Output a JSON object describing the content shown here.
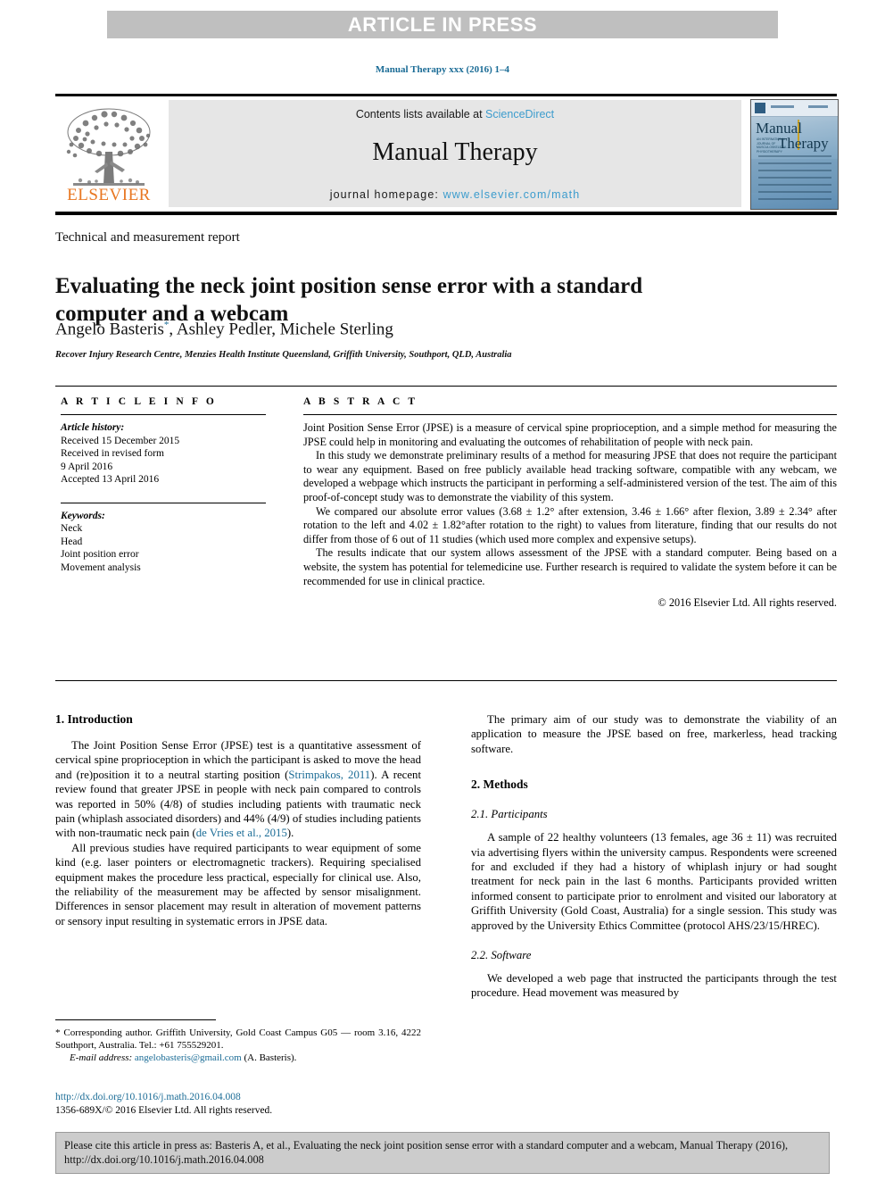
{
  "banner": {
    "text": "ARTICLE IN PRESS"
  },
  "running_head": "Manual Therapy xxx (2016) 1–4",
  "masthead": {
    "contents_prefix": "Contents lists available at ",
    "contents_link": "ScienceDirect",
    "journal_title": "Manual Therapy",
    "homepage_prefix": "journal homepage: ",
    "homepage_url": "www.elsevier.com/math",
    "publisher_wordmark": "ELSEVIER",
    "cover": {
      "title_part1": "Manual",
      "title_part2": "Therapy",
      "subtext": "AN INTERNATIONAL JOURNAL OF MUSCULOSKELETAL PHYSIOTHERAPY"
    }
  },
  "article": {
    "section_label": "Technical and measurement report",
    "title": "Evaluating the neck joint position sense error with a standard computer and a webcam",
    "authors": "Angelo Basteris",
    "corresponding_marker": "*",
    "authors_rest": ", Ashley Pedler, Michele Sterling",
    "affiliation": "Recover Injury Research Centre, Menzies Health Institute Queensland, Griffith University, Southport, QLD, Australia"
  },
  "article_info": {
    "heading": "A R T I C L E   I N F O",
    "history_label": "Article history:",
    "history": [
      "Received 15 December 2015",
      "Received in revised form",
      "9 April 2016",
      "Accepted 13 April 2016"
    ],
    "keywords_label": "Keywords:",
    "keywords": [
      "Neck",
      "Head",
      "Joint position error",
      "Movement analysis"
    ]
  },
  "abstract": {
    "heading": "A B S T R A C T",
    "paragraphs": [
      "Joint Position Sense Error (JPSE) is a measure of cervical spine proprioception, and a simple method for measuring the JPSE could help in monitoring and evaluating the outcomes of rehabilitation of people with neck pain.",
      "In this study we demonstrate preliminary results of a method for measuring JPSE that does not require the participant to wear any equipment. Based on free publicly available head tracking software, compatible with any webcam, we developed a webpage which instructs the participant in performing a self-administered version of the test. The aim of this proof-of-concept study was to demonstrate the viability of this system.",
      "We compared our absolute error values (3.68 ± 1.2° after extension, 3.46 ± 1.66° after flexion, 3.89 ± 2.34° after rotation to the left and 4.02 ± 1.82°after rotation to the right) to values from literature, finding that our results do not differ from those of 6 out of 11 studies (which used more complex and expensive setups).",
      "The results indicate that our system allows assessment of the JPSE with a standard computer. Being based on a website, the system has potential for telemedicine use. Further research is required to validate the system before it can be recommended for use in clinical practice."
    ],
    "copyright": "© 2016 Elsevier Ltd. All rights reserved."
  },
  "body": {
    "left": {
      "h1": "1. Introduction",
      "p1_a": "The Joint Position Sense Error (JPSE) test is a quantitative assessment of cervical spine proprioception in which the participant is asked to move the head and (re)position it to a neutral starting position (",
      "p1_cite1": "Strimpakos, 2011",
      "p1_b": "). A recent review found that greater JPSE in people with neck pain compared to controls was reported in 50% (4/8) of studies including patients with traumatic neck pain (whiplash associated disorders) and 44% (4/9) of studies including patients with non-traumatic neck pain (",
      "p1_cite2": "de Vries et al., 2015",
      "p1_c": ").",
      "p2": "All previous studies have required participants to wear equipment of some kind (e.g. laser pointers or electromagnetic trackers). Requiring specialised equipment makes the procedure less practical, especially for clinical use. Also, the reliability of the measurement may be affected by sensor misalignment. Differences in sensor placement may result in alteration of movement patterns or sensory input resulting in systematic errors in JPSE data."
    },
    "right": {
      "p1": "The primary aim of our study was to demonstrate the viability of an application to measure the JPSE based on free, markerless, head tracking software.",
      "h1": "2. Methods",
      "h2_1": "2.1. Participants",
      "p2": "A sample of 22 healthy volunteers (13 females, age 36 ± 11) was recruited via advertising flyers within the university campus. Respondents were screened for and excluded if they had a history of whiplash injury or had sought treatment for neck pain in the last 6 months. Participants provided written informed consent to participate prior to enrolment and visited our laboratory at Griffith University (Gold Coast, Australia) for a single session. This study was approved by the University Ethics Committee (protocol AHS/23/15/HREC).",
      "h2_2": "2.2. Software",
      "p3": "We developed a web page that instructed the participants through the test procedure. Head movement was measured by"
    }
  },
  "footnote": {
    "marker": "*",
    "corresponding": " Corresponding author. Griffith University, Gold Coast Campus G05 — room 3.16, 4222 Southport, Australia. Tel.: +61 755529201.",
    "email_label": "E-mail address:",
    "email": "angelobasteris@gmail.com",
    "email_suffix": " (A. Basteris)."
  },
  "doi": {
    "url": "http://dx.doi.org/10.1016/j.math.2016.04.008",
    "issn_line": "1356-689X/© 2016 Elsevier Ltd. All rights reserved."
  },
  "cite_box": {
    "text": "Please cite this article in press as: Basteris A, et al., Evaluating the neck joint position sense error with a standard computer and a webcam, Manual Therapy (2016), http://dx.doi.org/10.1016/j.math.2016.04.008"
  },
  "colors": {
    "link": "#1b6c96",
    "sciencedirect": "#3c9ccd",
    "elsevier_orange": "#e87722",
    "banner_bg": "#bfbfbf",
    "masthead_bg": "#e6e6e6",
    "cite_bg": "#cccccc"
  }
}
